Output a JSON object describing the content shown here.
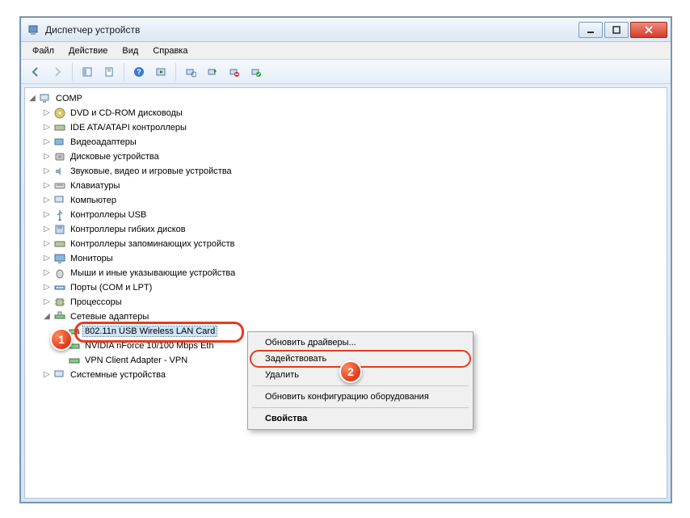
{
  "window": {
    "title": "Диспетчер устройств"
  },
  "menu": {
    "file": "Файл",
    "action": "Действие",
    "view": "Вид",
    "help": "Справка"
  },
  "tree": {
    "root": "COMP",
    "nodes": {
      "dvd": "DVD и CD-ROM дисководы",
      "ide": "IDE ATA/ATAPI контроллеры",
      "video": "Видеоадаптеры",
      "disk": "Дисковые устройства",
      "sound": "Звуковые, видео и игровые устройства",
      "keyboard": "Клавиатуры",
      "computer": "Компьютер",
      "usb": "Контроллеры USB",
      "floppy": "Контроллеры гибких дисков",
      "storage": "Контроллеры запоминающих устройств",
      "monitor": "Мониторы",
      "mouse": "Мыши и иные указывающие устройства",
      "ports": "Порты (COM и LPT)",
      "cpu": "Процессоры",
      "network": "Сетевые адаптеры",
      "net1": "802.11n USB Wireless LAN Card",
      "net2": "NVIDIA nForce 10/100 Mbps Eth",
      "net3": "VPN Client Adapter - VPN",
      "system": "Системные устройства"
    }
  },
  "context_menu": {
    "update_drivers": "Обновить драйверы...",
    "enable": "Задействовать",
    "delete": "Удалить",
    "scan": "Обновить конфигурацию оборудования",
    "properties": "Свойства"
  },
  "markers": {
    "one": "1",
    "two": "2"
  }
}
